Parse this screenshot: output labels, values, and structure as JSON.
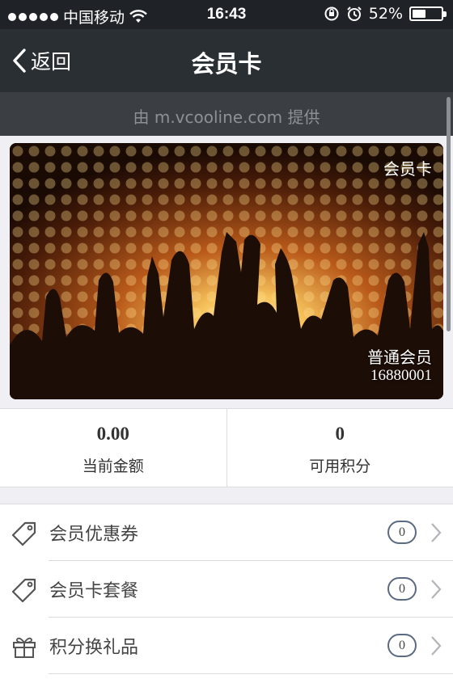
{
  "status_bar": {
    "carrier": "中国移动",
    "time": "16:43",
    "battery": "52%",
    "battery_level": 0.52
  },
  "nav": {
    "back_label": "返回",
    "title": "会员卡"
  },
  "provider_text": "由 m.vcooline.com 提供",
  "card": {
    "label": "会员卡",
    "level": "普通会员",
    "number": "16880001"
  },
  "stats": [
    {
      "value": "0.00",
      "label": "当前金额"
    },
    {
      "value": "0",
      "label": "可用积分"
    }
  ],
  "list": [
    {
      "icon": "tag-icon",
      "label": "会员优惠券",
      "count": "0"
    },
    {
      "icon": "tag-icon",
      "label": "会员卡套餐",
      "count": "0"
    },
    {
      "icon": "gift-icon",
      "label": "积分换礼品",
      "count": "0"
    }
  ],
  "colors": {
    "status_bar": "#1f2327",
    "nav_bar": "#2a2f33",
    "provider_strip": "#3b3f43",
    "badge_border": "#5a6a80"
  }
}
